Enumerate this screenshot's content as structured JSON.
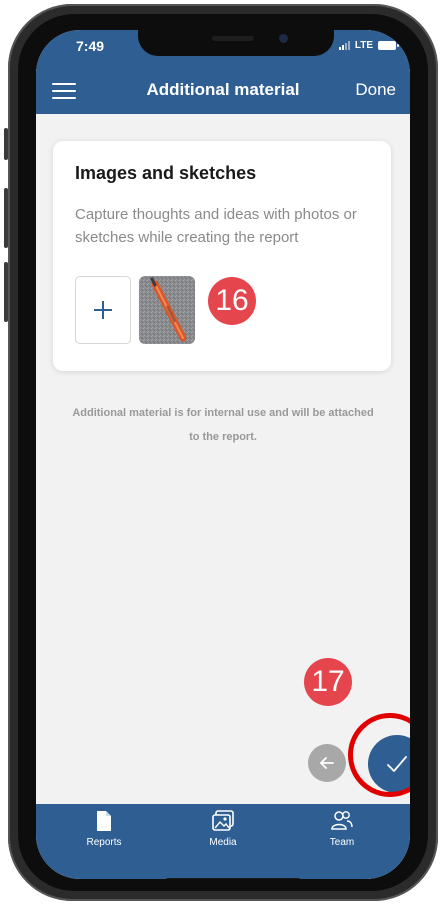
{
  "status_bar": {
    "time": "7:49",
    "network": "LTE"
  },
  "header": {
    "title": "Additional material",
    "done_label": "Done",
    "menu_icon": "hamburger-icon"
  },
  "card": {
    "title": "Images and sketches",
    "description": "Capture thoughts and ideas with photos or sketches while creating the report",
    "add_icon": "plus-icon"
  },
  "annotations": {
    "image_marker": "16",
    "done_marker": "17"
  },
  "note": "Additional material is for internal use and will be attached to the report.",
  "tabs": [
    {
      "label": "Reports",
      "icon": "document-icon"
    },
    {
      "label": "Media",
      "icon": "image-icon"
    },
    {
      "label": "Team",
      "icon": "people-icon"
    }
  ],
  "colors": {
    "brand": "#2f5f92",
    "badge": "#e5464e",
    "highlight_ring": "#e00000",
    "background": "#f2f2f2"
  }
}
